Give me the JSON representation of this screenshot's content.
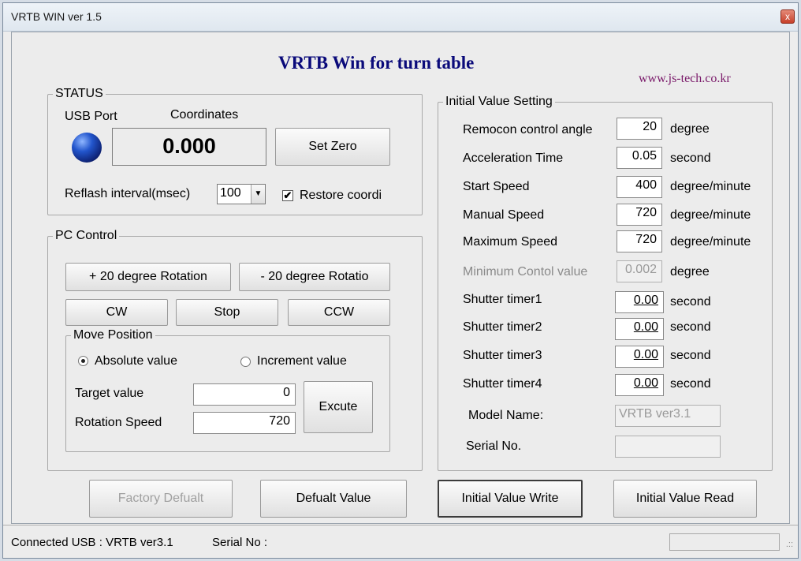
{
  "window": {
    "title": "VRTB WIN  ver 1.5",
    "close_label": "x"
  },
  "header": {
    "heading": "VRTB Win for turn table",
    "website": "www.js-tech.co.kr"
  },
  "status": {
    "group_label": "STATUS",
    "usb_port_label": "USB Port",
    "coordinates_label": "Coordinates",
    "coordinates_value": "0.000",
    "set_zero_label": "Set Zero",
    "reflash_label": "Reflash interval(msec)",
    "reflash_value": "100",
    "restore_checked_mark": "✔",
    "restore_label": "Restore coordi"
  },
  "pc_control": {
    "group_label": "PC Control",
    "plus_rotation_label": "+ 20 degree Rotation",
    "minus_rotation_label": "- 20 degree Rotatio",
    "cw_label": "CW",
    "stop_label": "Stop",
    "ccw_label": "CCW",
    "move_position": {
      "group_label": "Move Position",
      "absolute_label": "Absolute value",
      "increment_label": "Increment value",
      "selected": "absolute",
      "target_label": "Target value",
      "target_value": "0",
      "speed_label": "Rotation Speed",
      "speed_value": "720",
      "execute_label": "Excute"
    }
  },
  "initial_settings": {
    "group_label": "Initial Value Setting",
    "rows": [
      {
        "label": "Remocon control angle",
        "value": "20",
        "unit": "degree"
      },
      {
        "label": "Acceleration Time",
        "value": "0.05",
        "unit": "second"
      },
      {
        "label": "Start Speed",
        "value": "400",
        "unit": "degree/minute"
      },
      {
        "label": "Manual Speed",
        "value": "720",
        "unit": "degree/minute"
      },
      {
        "label": "Maximum Speed",
        "value": "720",
        "unit": "degree/minute"
      },
      {
        "label": "Minimum Contol value",
        "value": "0.002",
        "unit": "degree"
      },
      {
        "label": "Shutter timer1",
        "value": "0.00",
        "unit": "second"
      },
      {
        "label": "Shutter timer2",
        "value": "0.00",
        "unit": "second"
      },
      {
        "label": "Shutter timer3",
        "value": "0.00",
        "unit": "second"
      },
      {
        "label": "Shutter timer4",
        "value": "0.00",
        "unit": "second"
      }
    ],
    "model_name_label": "Model Name:",
    "model_name_value": "VRTB  ver3.1",
    "serial_label": "Serial No.",
    "serial_value": ""
  },
  "buttons": {
    "factory_default": "Factory Defualt",
    "default_value": "Defualt Value",
    "initial_write": "Initial Value Write",
    "initial_read": "Initial Value Read"
  },
  "statusbar": {
    "connected_text": "Connected USB : VRTB ver3.1",
    "serial_text": "Serial No :",
    "grip": ".::"
  }
}
